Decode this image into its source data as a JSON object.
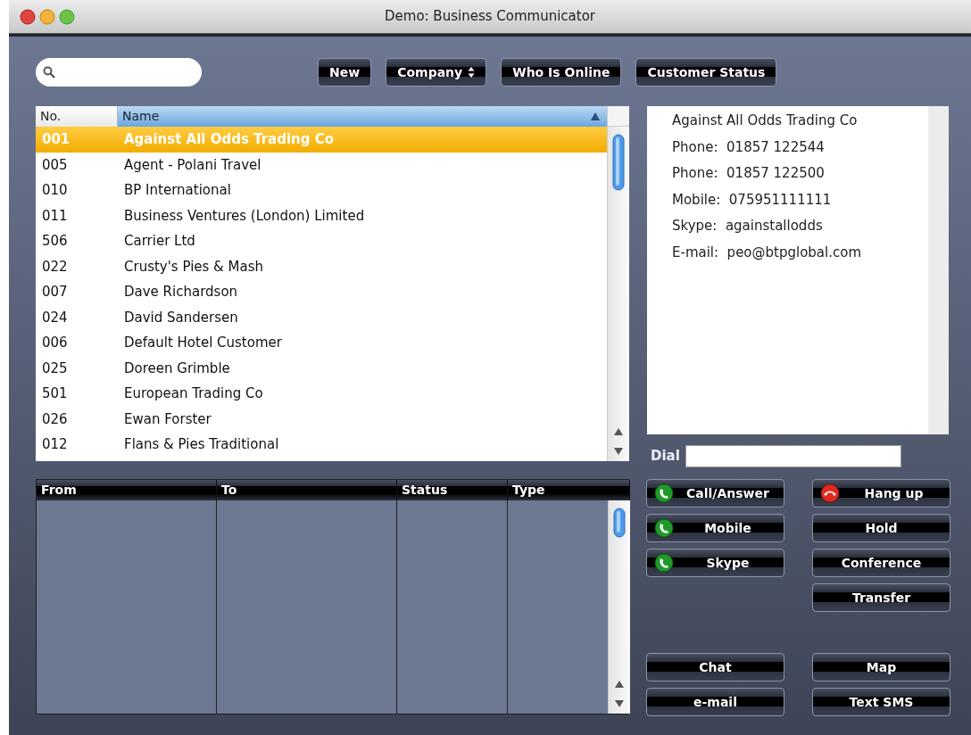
{
  "window": {
    "title": "Demo: Business Communicator"
  },
  "toolbar": [
    {
      "label": "New",
      "kind": "plain"
    },
    {
      "label": "Company",
      "kind": "popup"
    },
    {
      "label": "Who Is Online",
      "kind": "plain"
    },
    {
      "label": "Customer Status",
      "kind": "plain"
    }
  ],
  "customers": {
    "columns": [
      {
        "label": "No.",
        "sorted": false
      },
      {
        "label": "Name",
        "sorted": true
      }
    ],
    "rows": [
      {
        "no": "001",
        "name": "Against All Odds Trading Co",
        "selected": true
      },
      {
        "no": "005",
        "name": "Agent - Polani Travel",
        "selected": false
      },
      {
        "no": "010",
        "name": "BP International",
        "selected": false
      },
      {
        "no": "011",
        "name": "Business Ventures (London) Limited",
        "selected": false
      },
      {
        "no": "506",
        "name": "Carrier Ltd",
        "selected": false
      },
      {
        "no": "022",
        "name": "Crusty's Pies & Mash",
        "selected": false
      },
      {
        "no": "007",
        "name": "Dave Richardson",
        "selected": false
      },
      {
        "no": "024",
        "name": "David Sandersen",
        "selected": false
      },
      {
        "no": "006",
        "name": "Default Hotel Customer",
        "selected": false
      },
      {
        "no": "025",
        "name": "Doreen Grimble",
        "selected": false
      },
      {
        "no": "501",
        "name": "European Trading Co",
        "selected": false
      },
      {
        "no": "026",
        "name": "Ewan Forster",
        "selected": false
      },
      {
        "no": "012",
        "name": "Flans & Pies Traditional",
        "selected": false
      }
    ]
  },
  "details": {
    "title": "Against All Odds Trading Co",
    "fields": [
      {
        "label": "Phone:",
        "value": "01857 122544"
      },
      {
        "label": "Phone:",
        "value": "01857 122500"
      },
      {
        "label": "Mobile:",
        "value": "075951111111"
      },
      {
        "label": "Skype:",
        "value": "againstallodds"
      },
      {
        "label": "E-mail:",
        "value": "peo@btpglobal.com"
      }
    ]
  },
  "dial": {
    "label": "Dial"
  },
  "calls": {
    "columns": [
      "From",
      "To",
      "Status",
      "Type"
    ]
  },
  "call_actions": [
    {
      "label": "Call/Answer",
      "kind": "call"
    },
    {
      "label": "Mobile",
      "kind": "call"
    },
    {
      "label": "Skype",
      "kind": "call"
    }
  ],
  "line_actions": [
    {
      "label": "Hang up",
      "kind": "hangup"
    },
    {
      "label": "Hold",
      "kind": "plain"
    },
    {
      "label": "Conference",
      "kind": "plain"
    },
    {
      "label": "Transfer",
      "kind": "plain"
    }
  ],
  "bottom_actions": [
    {
      "label": "Chat"
    },
    {
      "label": "Map"
    },
    {
      "label": "e-mail"
    },
    {
      "label": "Text SMS"
    }
  ]
}
